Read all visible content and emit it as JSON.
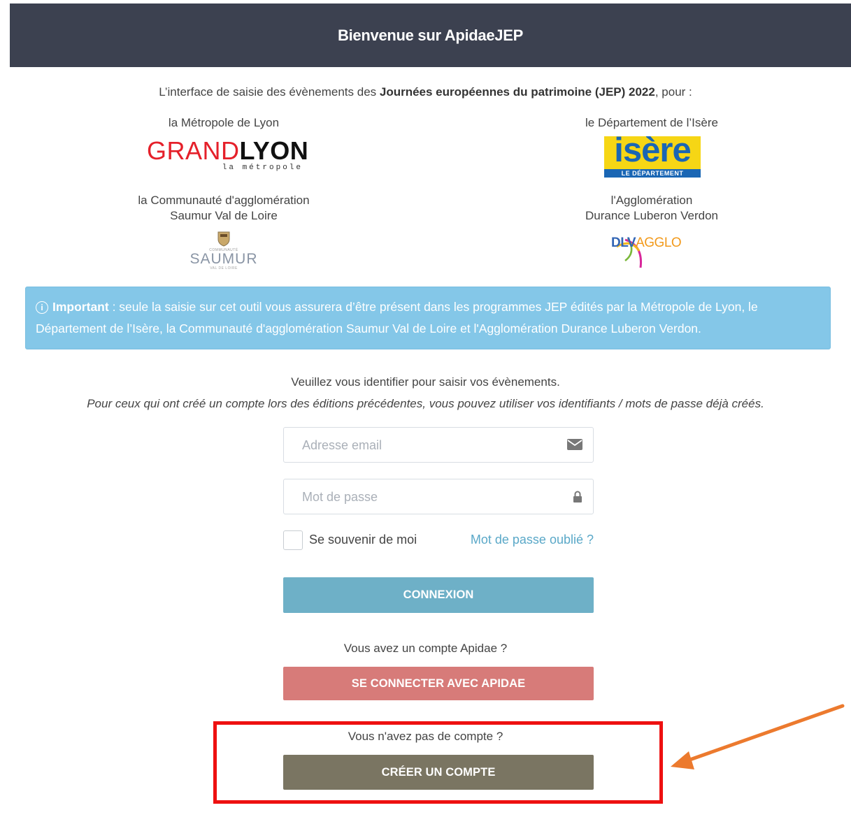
{
  "header": {
    "title": "Bienvenue sur ApidaeJEP"
  },
  "intro": {
    "prefix": "L’interface de saisie des évènements des ",
    "bold": "Journées européennes du patrimoine (JEP) 2022",
    "suffix": ", pour :"
  },
  "partners": {
    "lyon": {
      "label": "la Métropole de Lyon",
      "logo_main_a": "GRAND",
      "logo_main_b": "LYON",
      "logo_sub": "la métropole"
    },
    "isere": {
      "label": "le Département de l’Isère",
      "logo_main": "isère",
      "logo_sub": "LE DÉPARTEMENT"
    },
    "saumur": {
      "label_line1": "la Communauté d'agglomération",
      "label_line2": "Saumur Val de Loire",
      "logo_main": "SAUMUR",
      "logo_top": "COMMUNAUTÉ",
      "logo_sub": "VAL DE LOIRE"
    },
    "dlva": {
      "label_line1": "l'Agglomération",
      "label_line2": "Durance Luberon Verdon",
      "logo_main_a": "DLV",
      "logo_main_b": "AGGLO"
    }
  },
  "alert": {
    "icon": "info-circle-icon",
    "bold": "Important",
    "text": " : seule la saisie sur cet outil vous assurera d’être présent dans les programmes JEP édités par la Métropole de Lyon, le Département de l’Isère, la Communauté d'agglomération Saumur Val de Loire et l'Agglomération Durance Luberon Verdon."
  },
  "login": {
    "instruction": "Veuillez vous identifier pour saisir vos évènements.",
    "note": "Pour ceux qui ont créé un compte lors des éditions précédentes, vous pouvez utiliser vos identifiants / mots de passe déjà créés.",
    "email_placeholder": "Adresse email",
    "password_placeholder": "Mot de passe",
    "remember_label": "Se souvenir de moi",
    "forgot_link": "Mot de passe oublié ?",
    "connect_button": "CONNEXION",
    "apidae_question": "Vous avez un compte Apidae ?",
    "apidae_button": "SE CONNECTER AVEC APIDAE",
    "no_account_question": "Vous n'avez pas de compte ?",
    "create_button": "CRÉER UN COMPTE"
  },
  "colors": {
    "header_bg": "#3c4150",
    "alert_bg": "#84c7e8",
    "connect_bg": "#6eb0c7",
    "apidae_bg": "#d77b79",
    "create_bg": "#7a7562",
    "highlight": "#ee1010",
    "arrow": "#ec7a2e",
    "link": "#5aa8c8"
  }
}
